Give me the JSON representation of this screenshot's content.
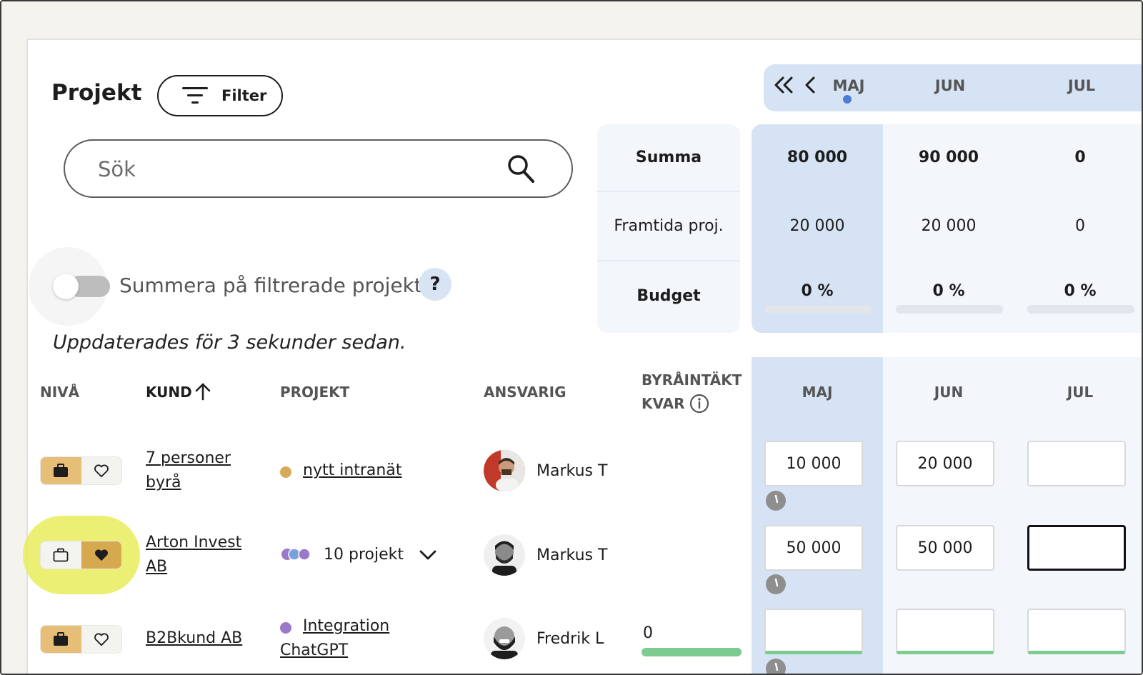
{
  "header": {
    "title": "Projekt",
    "filter_label": "Filter"
  },
  "search": {
    "placeholder": "Sök",
    "value": ""
  },
  "toggle": {
    "label": "Summera på filtrerade projekt",
    "on": false,
    "help": "?"
  },
  "updated_text": "Uppdaterades för 3 sekunder sedan.",
  "month_nav": {
    "months": [
      "MAJ",
      "JUN",
      "JUL"
    ],
    "current": "MAJ"
  },
  "summary": {
    "rows": [
      {
        "label": "Summa",
        "bold": true,
        "values": [
          "80 000",
          "90 000",
          "0"
        ]
      },
      {
        "label": "Framtida proj.",
        "bold": false,
        "values": [
          "20 000",
          "20 000",
          "0"
        ]
      },
      {
        "label": "Budget",
        "bold": true,
        "values": [
          "0 %",
          "0 %",
          "0 %"
        ],
        "progress": [
          0,
          0,
          0
        ]
      }
    ]
  },
  "table": {
    "headers": {
      "level": "NIVÅ",
      "client": "KUND",
      "project": "PROJEKT",
      "responsible": "ANSVARIG",
      "remaining_line1": "BYRÅINTÄKT",
      "remaining_line2": "KVAR",
      "months": [
        "MAJ",
        "JUN",
        "JUL"
      ]
    },
    "rows": [
      {
        "level": "briefcase",
        "client_line1": "7 personer",
        "client_line2": "byrå",
        "project": "nytt intranät",
        "project_dot": "#d9a95a",
        "responsible": "Markus T",
        "remaining": "",
        "months": [
          "10 000",
          "20 000",
          ""
        ]
      },
      {
        "level": "heart",
        "client_line1": "Arton Invest",
        "client_line2": "AB",
        "project": "10 projekt",
        "responsible": "Markus T",
        "remaining": "",
        "months": [
          "50 000",
          "50 000",
          ""
        ]
      },
      {
        "level": "briefcase",
        "client_line1": "B2Bkund AB",
        "project_line1": "Integration",
        "project_line2": "ChatGPT",
        "project_dot": "#9b79c9",
        "responsible": "Fredrik L",
        "remaining": "0",
        "months": [
          "",
          "",
          ""
        ]
      }
    ]
  },
  "colors": {
    "accent_blue": "#d6e3f4",
    "level_gold": "#d7a94f",
    "highlight_yellow": "#e8ec5a",
    "progress_green": "#7ccb8f"
  }
}
